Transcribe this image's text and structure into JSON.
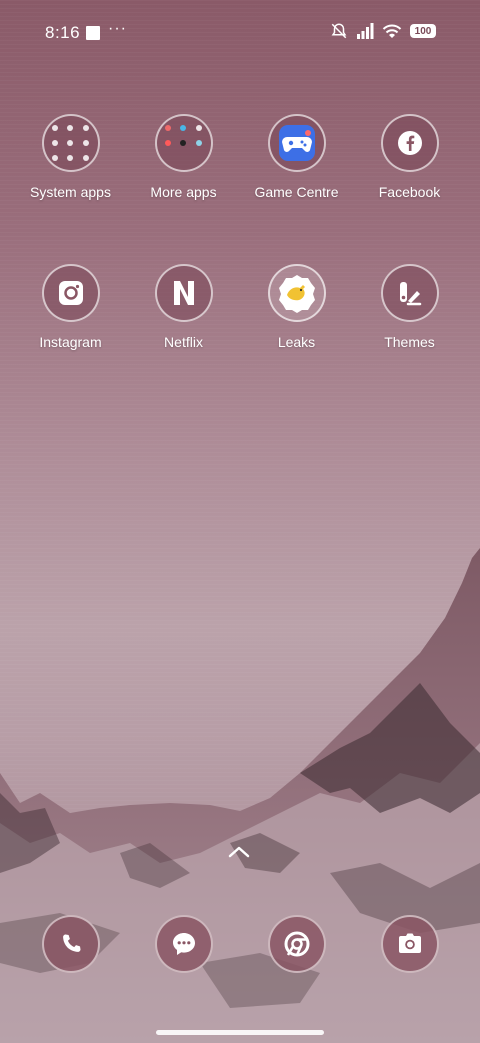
{
  "status_bar": {
    "time": "8:16",
    "dots": "···",
    "battery": "100"
  },
  "apps_row1": [
    {
      "label": "System apps",
      "icon": "folder-icon"
    },
    {
      "label": "More apps",
      "icon": "folder-icon"
    },
    {
      "label": "Game Centre",
      "icon": "game-controller-icon"
    },
    {
      "label": "Facebook",
      "icon": "facebook-icon"
    }
  ],
  "apps_row2": [
    {
      "label": "Instagram",
      "icon": "instagram-icon"
    },
    {
      "label": "Netflix",
      "icon": "netflix-icon"
    },
    {
      "label": "Leaks",
      "icon": "bird-icon"
    },
    {
      "label": "Themes",
      "icon": "themes-icon"
    }
  ],
  "dock": [
    {
      "icon": "phone-icon"
    },
    {
      "icon": "messages-icon"
    },
    {
      "icon": "chrome-icon"
    },
    {
      "icon": "camera-icon"
    }
  ],
  "colors": {
    "icon_bg": "#8a5664",
    "game_centre_blue": "#3d6fe6",
    "leaks_yellow": "#f1c232"
  }
}
